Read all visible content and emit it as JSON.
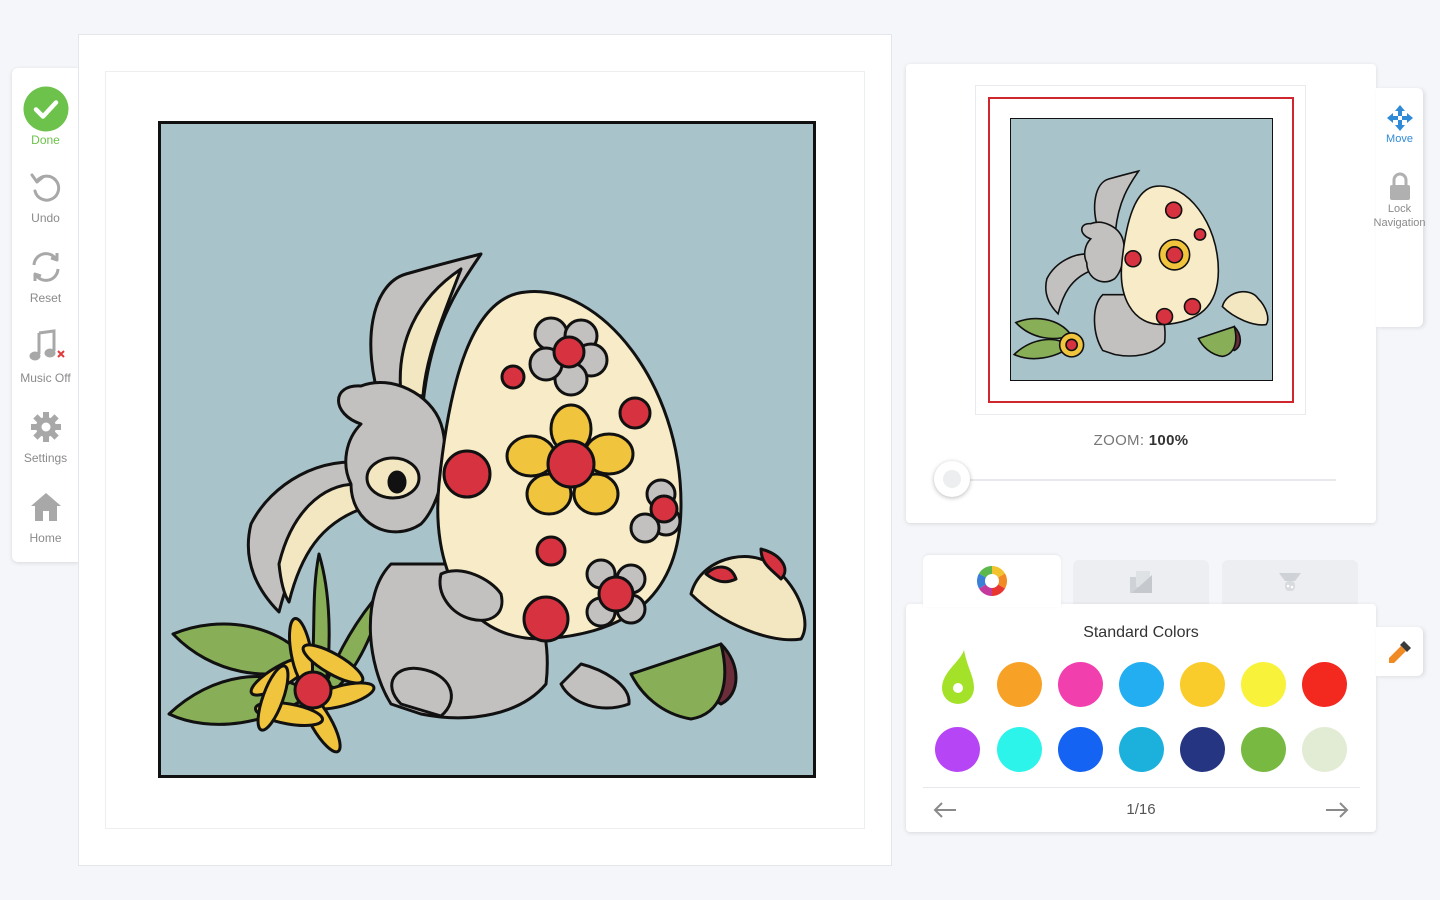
{
  "toolbar": {
    "done_label": "Done",
    "undo_label": "Undo",
    "reset_label": "Reset",
    "music_label": "Music Off",
    "settings_label": "Settings",
    "home_label": "Home"
  },
  "navigator": {
    "zoom_prefix": "ZOOM:",
    "zoom_value": "100%",
    "zoom_level": 1.0
  },
  "side_tools": {
    "move_label": "Move",
    "lock_label_1": "Lock",
    "lock_label_2": "Navigation"
  },
  "palette": {
    "title": "Standard Colors",
    "page_indicator": "1/16",
    "selected_color": "#a4e22a",
    "colors": [
      "#f7a226",
      "#f23fae",
      "#23aef2",
      "#f9cc2c",
      "#f8f23a",
      "#f3291f",
      "#b646f5",
      "#2cf4ea",
      "#1563f2",
      "#1cb1dd",
      "#263581",
      "#78ba41",
      "#e2ecd4"
    ]
  },
  "colors": {
    "accent_green": "#6cc24a",
    "accent_blue": "#2f8bd8",
    "viewport_red": "#d0262d"
  }
}
